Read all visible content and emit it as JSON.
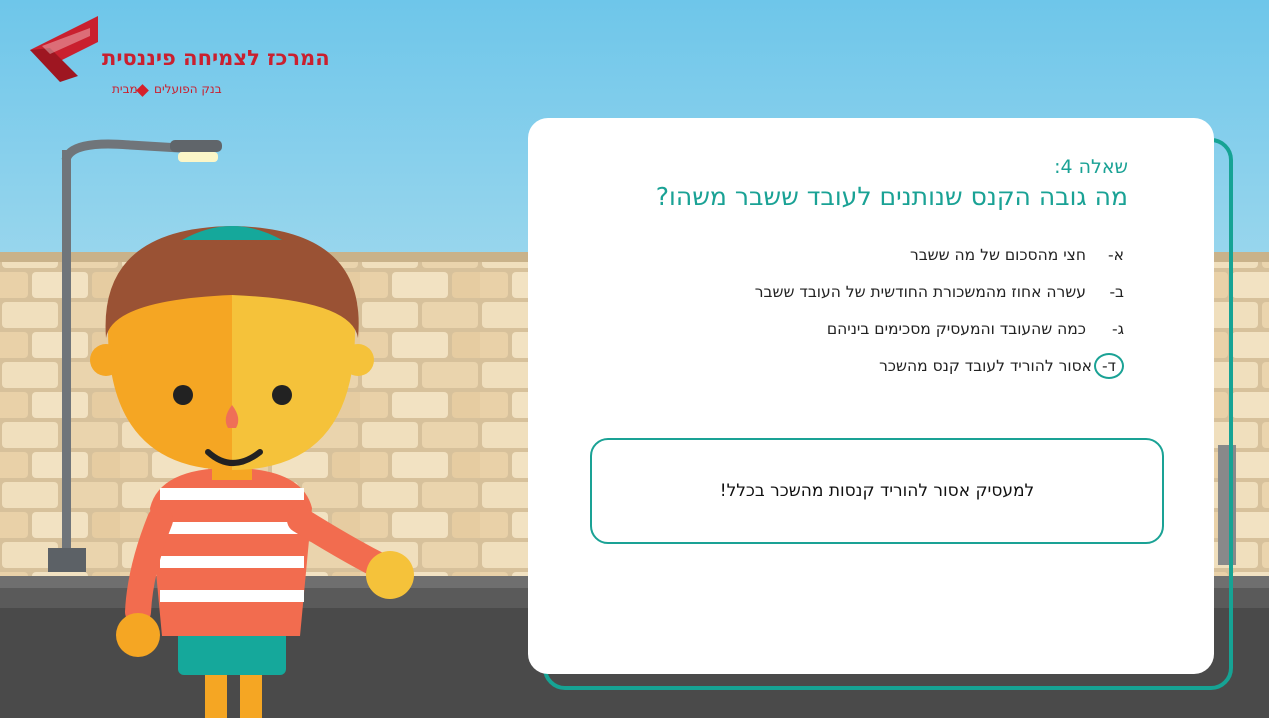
{
  "logo": {
    "title": "המרכז לצמיחה פיננסית",
    "subtitle_left": "בנק הפועלים",
    "subtitle_right": "מבית"
  },
  "question": {
    "number": "שאלה 4:",
    "text": "מה גובה הקנס שנותנים לעובד ששבר משהו?",
    "answers": [
      {
        "letter": "א-",
        "text": "חצי מהסכום של מה ששבר",
        "selected": false
      },
      {
        "letter": "ב-",
        "text": "עשרה אחוז מהמשכורת החודשית של העובד ששבר",
        "selected": false
      },
      {
        "letter": "ג-",
        "text": "כמה שהעובד והמעסיק מסכימים ביניהם",
        "selected": false
      },
      {
        "letter": "ד-",
        "text": "אסור להוריד לעובד קנס מהשכר",
        "selected": true
      }
    ]
  },
  "feedback": {
    "text": "למעסיק אסור להוריד קנסות מהשכר בכלל!"
  },
  "colors": {
    "accent": "#1aa295",
    "brand": "#c9202f"
  }
}
